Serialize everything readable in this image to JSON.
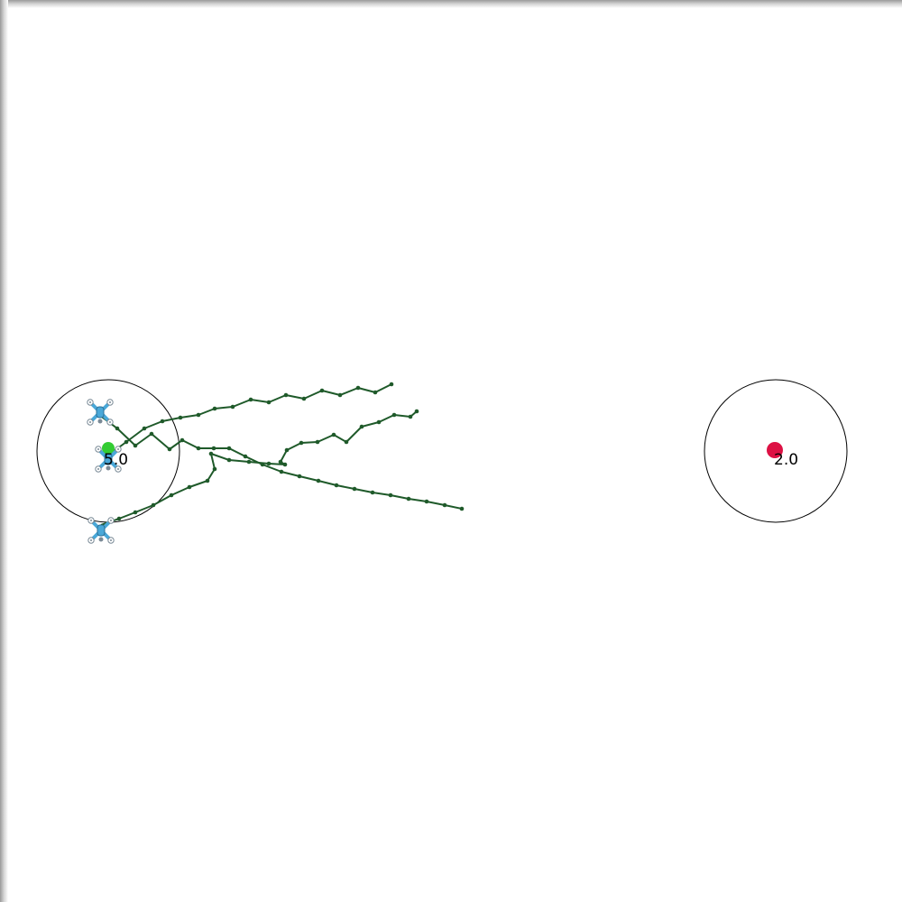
{
  "colors": {
    "trail": "#1f5a2a",
    "zone_outline": "#000000",
    "start_marker": "#33cc33",
    "goal_marker": "#dd1144",
    "drone_body": "#4aa8d8",
    "drone_rotor": "#7a8a96"
  },
  "zones": [
    {
      "name": "start-zone",
      "label": "5.0"
    },
    {
      "name": "goal-zone",
      "label": "2.0"
    }
  ],
  "drones": [
    {
      "name": "drone-1",
      "icon": "quadcopter-icon"
    },
    {
      "name": "drone-2",
      "icon": "quadcopter-icon"
    },
    {
      "name": "drone-3",
      "icon": "quadcopter-icon"
    }
  ]
}
